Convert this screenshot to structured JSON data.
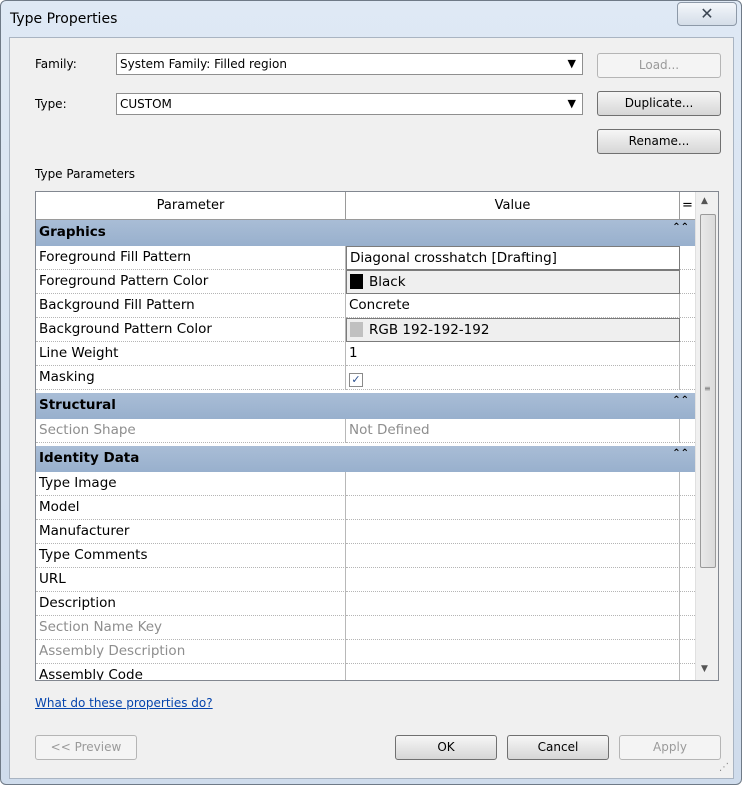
{
  "window": {
    "title": "Type Properties",
    "close_label": "✕"
  },
  "family": {
    "label": "Family:",
    "value": "System Family: Filled region"
  },
  "type": {
    "label": "Type:",
    "value": "CUSTOM"
  },
  "buttons": {
    "load": "Load...",
    "duplicate": "Duplicate...",
    "rename": "Rename...",
    "preview": "<< Preview",
    "ok": "OK",
    "cancel": "Cancel",
    "apply": "Apply"
  },
  "section_label": "Type Parameters",
  "grid": {
    "headers": {
      "parameter": "Parameter",
      "value": "Value",
      "extra": "="
    },
    "groups": {
      "graphics": "Graphics",
      "structural": "Structural",
      "identity": "Identity Data"
    },
    "rows": {
      "fg_fill": {
        "param": "Foreground Fill Pattern",
        "value": "Diagonal crosshatch [Drafting]"
      },
      "fg_color": {
        "param": "Foreground Pattern Color",
        "value": "Black",
        "swatch": "#000000"
      },
      "bg_fill": {
        "param": "Background Fill Pattern",
        "value": "Concrete"
      },
      "bg_color": {
        "param": "Background Pattern Color",
        "value": "RGB 192-192-192",
        "swatch": "#c0c0c0"
      },
      "line_weight": {
        "param": "Line Weight",
        "value": "1"
      },
      "masking": {
        "param": "Masking",
        "checked": true
      },
      "section_shape": {
        "param": "Section Shape",
        "value": "Not Defined"
      },
      "type_image": {
        "param": "Type Image",
        "value": ""
      },
      "model": {
        "param": "Model",
        "value": ""
      },
      "manufacturer": {
        "param": "Manufacturer",
        "value": ""
      },
      "type_comments": {
        "param": "Type Comments",
        "value": ""
      },
      "url": {
        "param": "URL",
        "value": ""
      },
      "description": {
        "param": "Description",
        "value": ""
      },
      "section_name_key": {
        "param": "Section Name Key",
        "value": ""
      },
      "assembly_description": {
        "param": "Assembly Description",
        "value": ""
      },
      "assembly_code": {
        "param": "Assembly Code",
        "value": ""
      }
    }
  },
  "help_link": "What do these properties do?",
  "colors": {
    "group_band": "#a3b8d3",
    "link": "#0645ad"
  }
}
